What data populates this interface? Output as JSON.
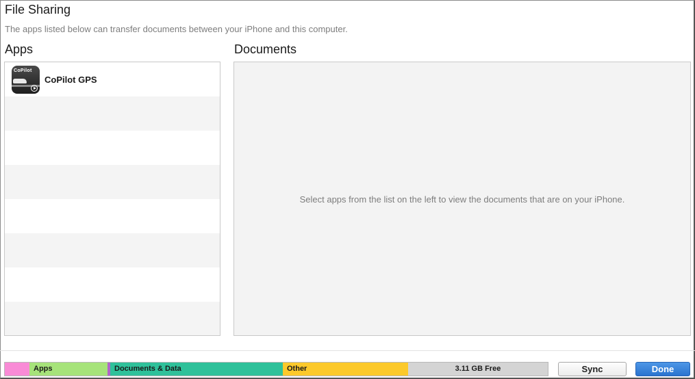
{
  "header": {
    "title": "File Sharing",
    "subtitle": "The apps listed below can transfer documents between your iPhone and this computer."
  },
  "apps_panel": {
    "heading": "Apps",
    "items": [
      {
        "name": "CoPilot GPS",
        "icon": "copilot-app-icon",
        "icon_text": "CoPilot"
      }
    ]
  },
  "documents_panel": {
    "heading": "Documents",
    "empty_message": "Select apps from the list on the left to view the documents that are on your iPhone."
  },
  "storage_bar": {
    "segments": [
      {
        "label": "",
        "color": "#f98bd6"
      },
      {
        "label": "Apps",
        "color": "#a6e37a"
      },
      {
        "label": "",
        "color": "#b066c8"
      },
      {
        "label": "Documents & Data",
        "color": "#2fc19a"
      },
      {
        "label": "Other",
        "color": "#fcc92b"
      }
    ],
    "free_label": "3.11 GB Free"
  },
  "buttons": {
    "sync_label": "Sync",
    "done_label": "Done",
    "done_color": "#2b73cf"
  }
}
